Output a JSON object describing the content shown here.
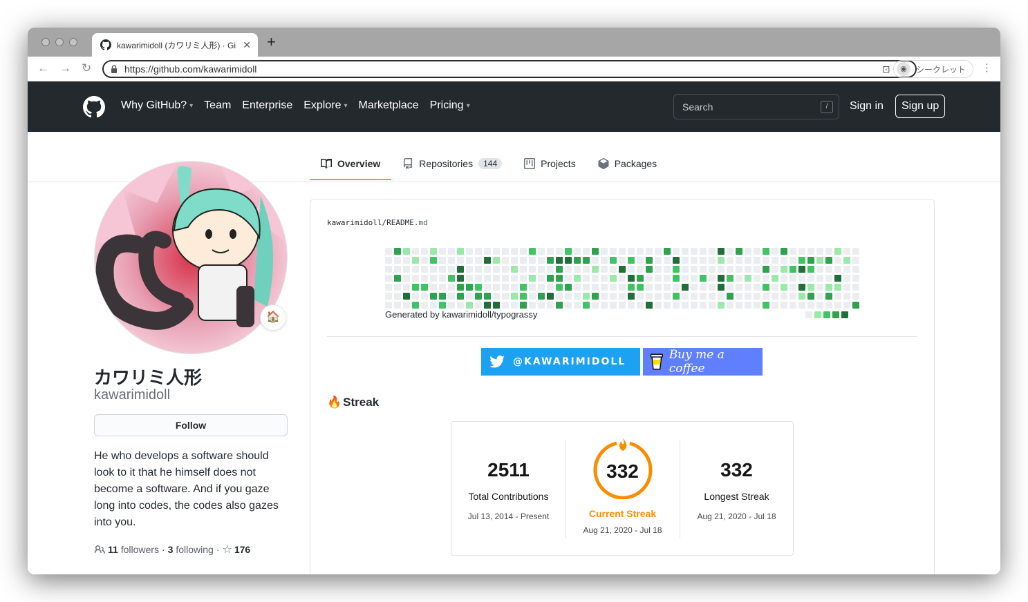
{
  "browser": {
    "tab_title": "kawarimidoll (カワリミ人形) · Gi",
    "new_tab": "+",
    "url": "https://github.com/kawarimidoll",
    "profile_label": "シークレット"
  },
  "header": {
    "nav": [
      {
        "label": "Why GitHub?",
        "caret": true
      },
      {
        "label": "Team",
        "caret": false
      },
      {
        "label": "Enterprise",
        "caret": false
      },
      {
        "label": "Explore",
        "caret": true
      },
      {
        "label": "Marketplace",
        "caret": false
      },
      {
        "label": "Pricing",
        "caret": true
      }
    ],
    "search_placeholder": "Search",
    "search_hotkey": "/",
    "sign_in": "Sign in",
    "sign_up": "Sign up"
  },
  "tabs": [
    {
      "label": "Overview",
      "selected": true,
      "icon": "book-icon"
    },
    {
      "label": "Repositories",
      "count": "144",
      "icon": "repo-icon"
    },
    {
      "label": "Projects",
      "icon": "project-icon"
    },
    {
      "label": "Packages",
      "icon": "package-icon"
    }
  ],
  "profile": {
    "name": "カワリミ人形",
    "login": "kawarimidoll",
    "status_emoji": "🏠",
    "follow_label": "Follow",
    "bio": "He who develops a software should look to it that he himself does not become a software. And if you gaze long into codes, the codes also gazes into you.",
    "followers_count": "11",
    "followers_label": "followers",
    "following_count": "3",
    "following_label": "following",
    "stars_count": "176"
  },
  "readme": {
    "path_owner": "kawarimidoll",
    "path_sep": "/",
    "path_file": "README",
    "path_ext": ".md",
    "generated_text": "Generated by kawarimidoll/typograssy",
    "twitter_label": "@KAWARIMIDOLL",
    "bmc_label": "Buy me a coffee",
    "streak_heading": "Streak",
    "streak_emoji": "🔥",
    "colors": {
      "empty": "#ebedf0",
      "l1": "#9be9a8",
      "l2": "#40c463",
      "l3": "#30a14e",
      "l4": "#216e39"
    }
  },
  "streak": {
    "total": "2511",
    "total_label": "Total Contributions",
    "total_range": "Jul 13, 2014 - Present",
    "current": "332",
    "current_label": "Current Streak",
    "current_range": "Aug 21, 2020 - Jul 18",
    "longest": "332",
    "longest_label": "Longest Streak",
    "longest_range": "Aug 21, 2020 - Jul 18"
  }
}
